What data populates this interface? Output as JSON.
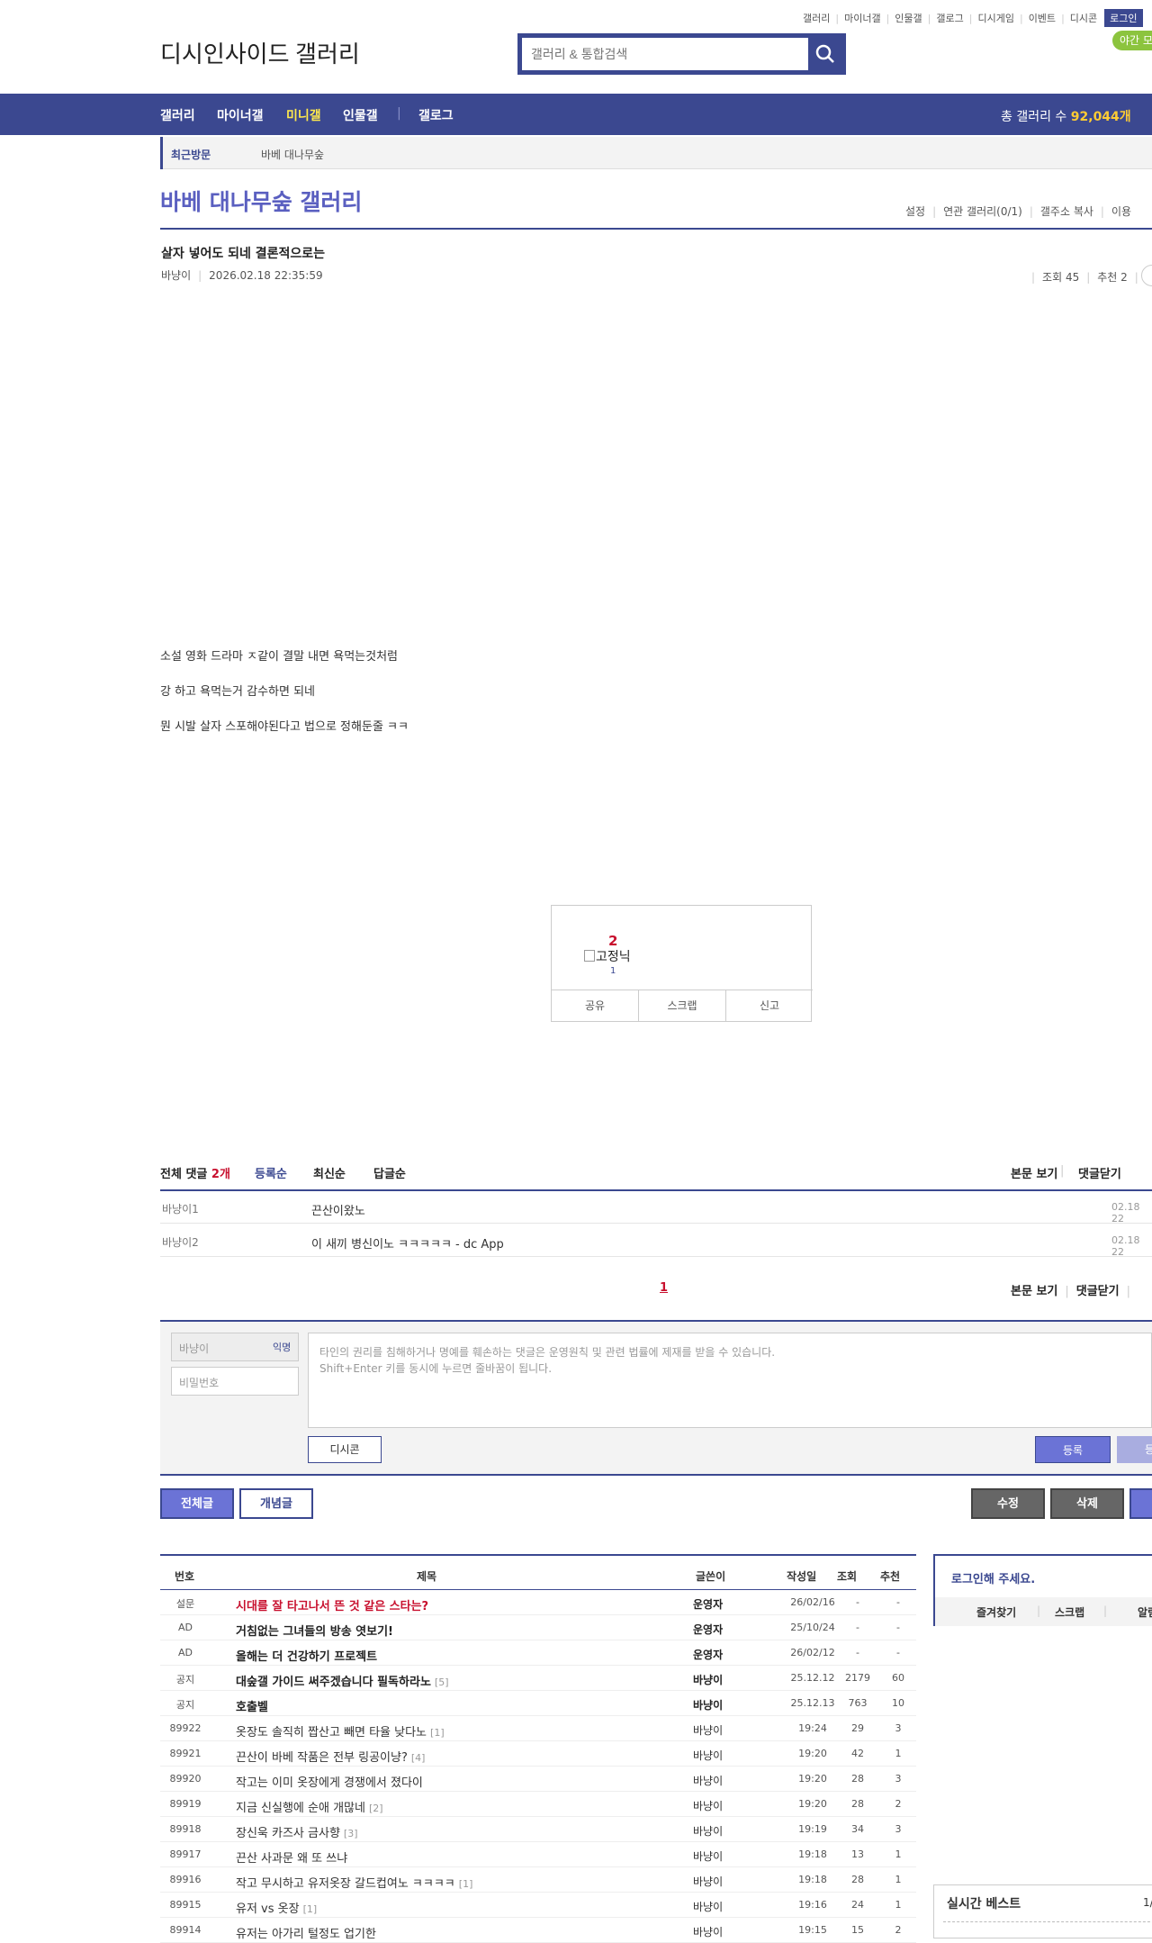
{
  "header": {
    "top_links": [
      "갤러리",
      "마이너갤",
      "인물갤",
      "갤로그",
      "디시게임",
      "이벤트",
      "디시콘"
    ],
    "login_label": "로그인",
    "night_mode_label": "야간 모",
    "logo_text": "디시인사이드 갤러리",
    "search_placeholder": "갤러리 & 통합검색"
  },
  "gnb": {
    "items": [
      "갤러리",
      "마이너갤",
      "미니갤",
      "인물갤",
      "갤로그"
    ],
    "total_label": "총 갤러리 수",
    "total_count": "92,044개"
  },
  "recent": {
    "label": "최근방문",
    "item": "바베 대나무숲"
  },
  "gallery": {
    "title": "바베 대나무숲 갤러리",
    "menu": [
      "설정",
      "연관 갤러리(0/1)",
      "갤주소 복사",
      "이용"
    ]
  },
  "post": {
    "title": "살자 넣어도 되네 결론적으로는",
    "writer": "바냥이",
    "date": "2026.02.18 22:35:59",
    "views": "조회 45",
    "recommend": "추천 2",
    "body": [
      "소설 영화 드라마 ㅈ같이 결말 내면 욕먹는것처럼",
      "강 하고 욕먹는거 감수하면 되네",
      "뭔 시발 살자 스포해야된다고 법으로 정해둔줄 ㅋㅋ"
    ]
  },
  "vote": {
    "count": "2",
    "fixed_label": "고정닉",
    "fixed_count": "1",
    "buttons": [
      "공유",
      "스크랩",
      "신고"
    ]
  },
  "comments": {
    "total_label": "전체 댓글",
    "total_count": "2개",
    "sorts": [
      "등록순",
      "최신순",
      "답글순"
    ],
    "actions": [
      "본문 보기",
      "댓글닫기"
    ],
    "items": [
      {
        "nick": "바냥이1",
        "text": "끈산이왔노",
        "date": "02.18 22"
      },
      {
        "nick": "바냥이2",
        "text": "이 새끼 병신이노 ㅋㅋㅋㅋㅋ - dc App",
        "date": "02.18 22"
      }
    ],
    "page": "1",
    "bottom_actions": [
      "본문 보기",
      "댓글닫기"
    ]
  },
  "write": {
    "nick_placeholder": "바냥이",
    "anon_tag": "익명",
    "pw_placeholder": "비밀번호",
    "memo_line1": "타인의 권리를 침해하거나 명예를 훼손하는 댓글은 운영원칙 및 관련 법률에 제재를 받을 수 있습니다.",
    "memo_line2": "Shift+Enter 키를 동시에 누르면 줄바꿈이 됩니다.",
    "dccon_label": "디시콘",
    "submit_label": "등록",
    "submit2_label": "등록"
  },
  "post_buttons": {
    "all": "전체글",
    "concept": "개념글",
    "edit": "수정",
    "delete": "삭제"
  },
  "list": {
    "headers": [
      "번호",
      "제목",
      "글쓴이",
      "작성일",
      "조회",
      "추천"
    ],
    "rows": [
      {
        "num": "설문",
        "title": "시대를 잘 타고나서 뜬 것 같은 스타는?",
        "reply": "",
        "writer": "운영자",
        "date": "26/02/16",
        "views": "-",
        "rec": "-",
        "style": "survey"
      },
      {
        "num": "AD",
        "title": "거침없는 그녀들의 방송 엿보기!",
        "reply": "",
        "writer": "운영자",
        "date": "25/10/24",
        "views": "-",
        "rec": "-",
        "style": "bold"
      },
      {
        "num": "AD",
        "title": "올해는 더 건강하기 프로젝트",
        "reply": "",
        "writer": "운영자",
        "date": "26/02/12",
        "views": "-",
        "rec": "-",
        "style": "bold"
      },
      {
        "num": "공지",
        "title": "대숲갤 가이드 써주겠습니다 필독하라노",
        "reply": "[5]",
        "writer": "바냥이",
        "date": "25.12.12",
        "views": "2179",
        "rec": "60",
        "style": "bold"
      },
      {
        "num": "공지",
        "title": "호출벨",
        "reply": "",
        "writer": "바냥이",
        "date": "25.12.13",
        "views": "763",
        "rec": "10",
        "style": "bold"
      },
      {
        "num": "89922",
        "title": "옷장도 솔직히 짭산고 빼면 타율 낮다노",
        "reply": "[1]",
        "writer": "바냥이",
        "date": "19:24",
        "views": "29",
        "rec": "3",
        "style": "normal"
      },
      {
        "num": "89921",
        "title": "끈산이 바베 작품은 전부 링공이냥?",
        "reply": "[4]",
        "writer": "바냥이",
        "date": "19:20",
        "views": "42",
        "rec": "1",
        "style": "normal"
      },
      {
        "num": "89920",
        "title": "작고는 이미 옷장에게 경쟁에서 졌다이",
        "reply": "",
        "writer": "바냥이",
        "date": "19:20",
        "views": "28",
        "rec": "3",
        "style": "normal"
      },
      {
        "num": "89919",
        "title": "지금 신실행에 순애 개많네",
        "reply": "[2]",
        "writer": "바냥이",
        "date": "19:20",
        "views": "28",
        "rec": "2",
        "style": "normal"
      },
      {
        "num": "89918",
        "title": "장신욱 카즈사 금사향",
        "reply": "[3]",
        "writer": "바냥이",
        "date": "19:19",
        "views": "34",
        "rec": "3",
        "style": "normal"
      },
      {
        "num": "89917",
        "title": "끈산 사과문 왜 또 쓰냐",
        "reply": "",
        "writer": "바냥이",
        "date": "19:18",
        "views": "13",
        "rec": "1",
        "style": "normal"
      },
      {
        "num": "89916",
        "title": "작고 무시하고 유저옷장 갈드컵여노 ㅋㅋㅋㅋ",
        "reply": "[1]",
        "writer": "바냥이",
        "date": "19:18",
        "views": "28",
        "rec": "1",
        "style": "normal"
      },
      {
        "num": "89915",
        "title": "유저 vs 옷장",
        "reply": "[1]",
        "writer": "바냥이",
        "date": "19:16",
        "views": "24",
        "rec": "1",
        "style": "normal"
      },
      {
        "num": "89914",
        "title": "유저는 아가리 털정도 업기한",
        "reply": "",
        "writer": "바냥이",
        "date": "19:15",
        "views": "15",
        "rec": "2",
        "style": "normal"
      }
    ]
  },
  "sidebar": {
    "login_prompt": "로그인해 주세요.",
    "login_links": [
      "즐겨찾기",
      "스크랩",
      "알림"
    ],
    "realtime_title": "실시간 베스트",
    "realtime_page": "1/"
  },
  "colors": {
    "brand": "#3b4890",
    "accent": "#5a5fc0",
    "red": "#c8102e",
    "gnb_highlight": "#ffcc33"
  }
}
